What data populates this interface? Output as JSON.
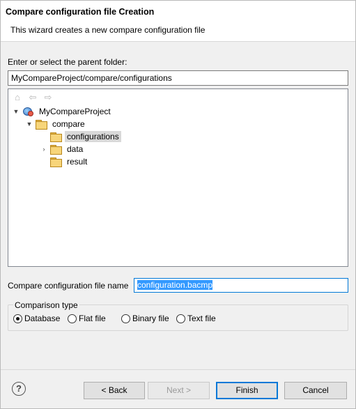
{
  "header": {
    "title": "Compare configuration file Creation",
    "description": "This wizard creates a new compare configuration file"
  },
  "parent_folder": {
    "label": "Enter or select the parent folder:",
    "value": "MyCompareProject/compare/configurations"
  },
  "tree": {
    "nav": [
      "home-icon",
      "back-arrow-icon",
      "forward-arrow-icon"
    ],
    "items": [
      {
        "label": "MyCompareProject",
        "icon": "project-icon",
        "expanded": true
      },
      {
        "label": "compare",
        "icon": "open-folder-icon",
        "expanded": true
      },
      {
        "label": "configurations",
        "icon": "open-folder-icon",
        "selected": true
      },
      {
        "label": "data",
        "icon": "folder-icon",
        "expanded": false
      },
      {
        "label": "result",
        "icon": "open-folder-icon"
      }
    ]
  },
  "file_name": {
    "label": "Compare configuration file name",
    "value": "configuration.bacmp"
  },
  "comparison_type": {
    "legend": "Comparison type",
    "options": [
      "Database",
      "Flat file",
      "Binary file",
      "Text file"
    ],
    "selected": "Database"
  },
  "buttons": {
    "back": "< Back",
    "next": "Next >",
    "finish": "Finish",
    "cancel": "Cancel",
    "help": "?"
  },
  "colors": {
    "selection": "#3399ff",
    "default_button_border": "#0078d7"
  }
}
